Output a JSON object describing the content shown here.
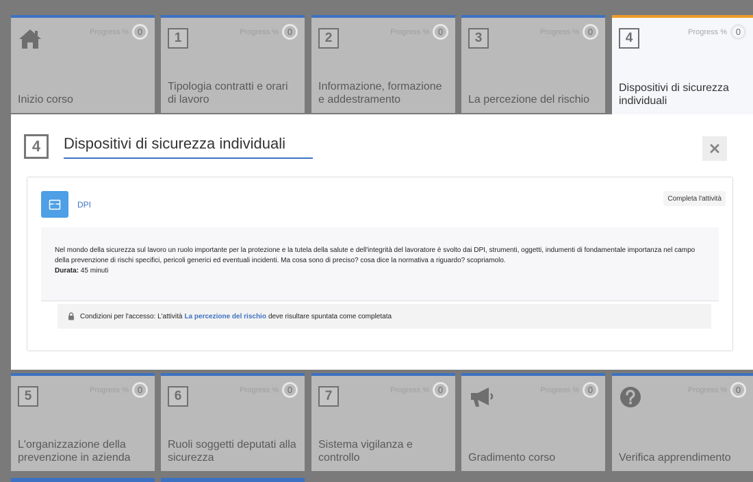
{
  "tiles_top": [
    {
      "number": "",
      "icon": "home-icon",
      "title": "Inizio corso",
      "progress_label": "Progress %",
      "progress_value": "0"
    },
    {
      "number": "1",
      "title": "Tipologia contratti e orari di lavoro",
      "progress_label": "Progress %",
      "progress_value": "0"
    },
    {
      "number": "2",
      "title": "Informazione, formazione e addestramento",
      "progress_label": "Progress %",
      "progress_value": "0"
    },
    {
      "number": "3",
      "title": "La percezione del rischio",
      "progress_label": "Progress %",
      "progress_value": "0"
    },
    {
      "number": "4",
      "title": "Dispositivi di sicurezza individuali",
      "progress_label": "Progress %",
      "progress_value": "0",
      "active": true
    }
  ],
  "tiles_bottom": [
    {
      "number": "5",
      "title": "L'organizzazione della prevenzione in azienda",
      "progress_label": "Progress %",
      "progress_value": "0"
    },
    {
      "number": "6",
      "title": "Ruoli soggetti deputati alla sicurezza",
      "progress_label": "Progress %",
      "progress_value": "0"
    },
    {
      "number": "7",
      "title": "Sistema vigilanza e controllo",
      "progress_label": "Progress %",
      "progress_value": "0"
    },
    {
      "number": "",
      "icon": "megaphone-icon",
      "title": "Gradimento corso",
      "progress_label": "Progress %",
      "progress_value": "0"
    },
    {
      "number": "",
      "icon": "question-circle-icon",
      "title": "Verifica apprendimento",
      "progress_label": "Progress %",
      "progress_value": "0"
    }
  ],
  "panel": {
    "number": "4",
    "title": "Dispositivi di sicurezza individuali",
    "close_icon": "close-icon",
    "activity": {
      "icon": "box-icon",
      "name": "DPI",
      "complete_label": "Completa l'attività",
      "description": "Nel mondo della sicurezza sul lavoro un ruolo importante per la protezione e la tutela della salute e dell'integrità del lavoratore è svolto dai DPI, strumenti, oggetti, indumenti di fondamentale importanza nel campo della prevenzione di rischi specifici, pericoli generici ed eventuali incidenti. Ma cosa sono di preciso? cosa dice la normativa a riguardo? scopriamolo.",
      "duration_label": "Durata:",
      "duration_value": "45 minuti",
      "access_prefix": "Condizioni per l'accesso: L'attività",
      "access_link": "La percezione del rischio",
      "access_suffix": "deve risultare spuntata come completata"
    }
  },
  "colors": {
    "accent": "#3d72c2",
    "active_border": "#ee9b2a",
    "activity_icon_bg": "#4d9fe6"
  }
}
